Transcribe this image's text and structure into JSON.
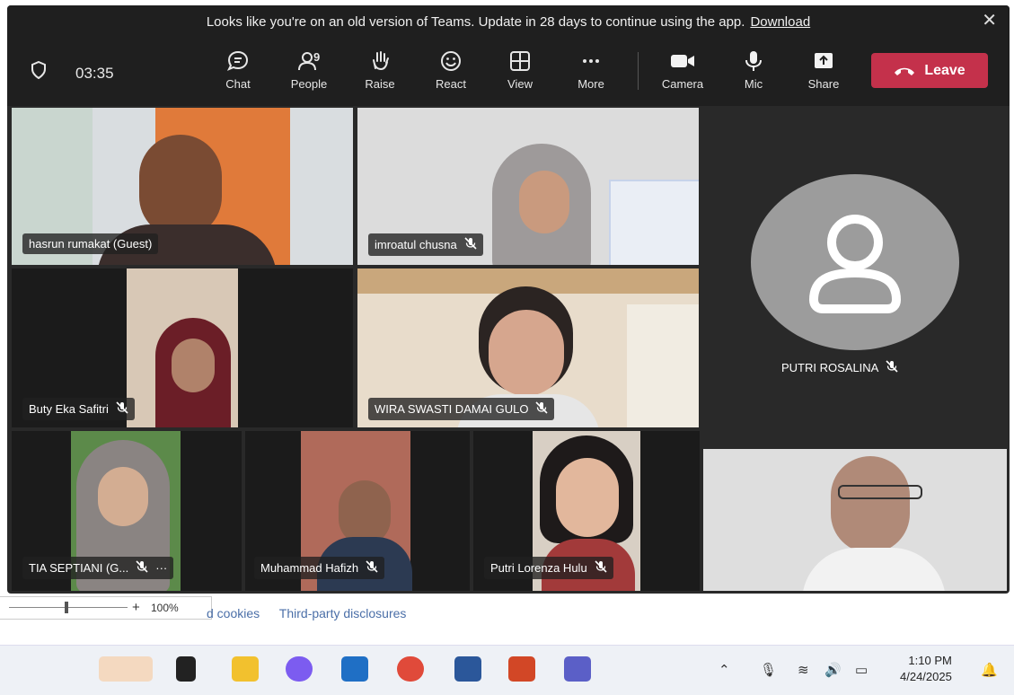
{
  "banner": {
    "text": "Looks like you're on an old version of Teams. Update in 28 days to continue using the app.",
    "link": "Download",
    "close": "✕"
  },
  "toolbar": {
    "timer": "03:35",
    "people_count": "9",
    "buttons": {
      "chat": "Chat",
      "people": "People",
      "raise": "Raise",
      "react": "React",
      "view": "View",
      "more": "More",
      "camera": "Camera",
      "mic": "Mic",
      "share": "Share"
    },
    "leave": "Leave"
  },
  "participants": [
    {
      "name": "hasrun rumakat (Guest)"
    },
    {
      "name": "imroatul chusna"
    },
    {
      "name": "PUTRI ROSALINA"
    },
    {
      "name": "Buty Eka Safitri"
    },
    {
      "name": "WIRA SWASTI DAMAI GULO"
    },
    {
      "name": "TIA SEPTIANI (G..."
    },
    {
      "name": "Muhammad Hafizh"
    },
    {
      "name": "Putri Lorenza Hulu"
    }
  ],
  "tile_more": "···",
  "zoom": {
    "plus": "+",
    "level": "100%"
  },
  "footer": {
    "cookies": "d cookies",
    "third_party": "Third-party disclosures"
  },
  "taskbar": {
    "time": "1:10 PM",
    "date": "4/24/2025"
  },
  "colors": {
    "leave": "#c4314b",
    "toolbar": "#1f1f1f",
    "stage": "#292929"
  }
}
